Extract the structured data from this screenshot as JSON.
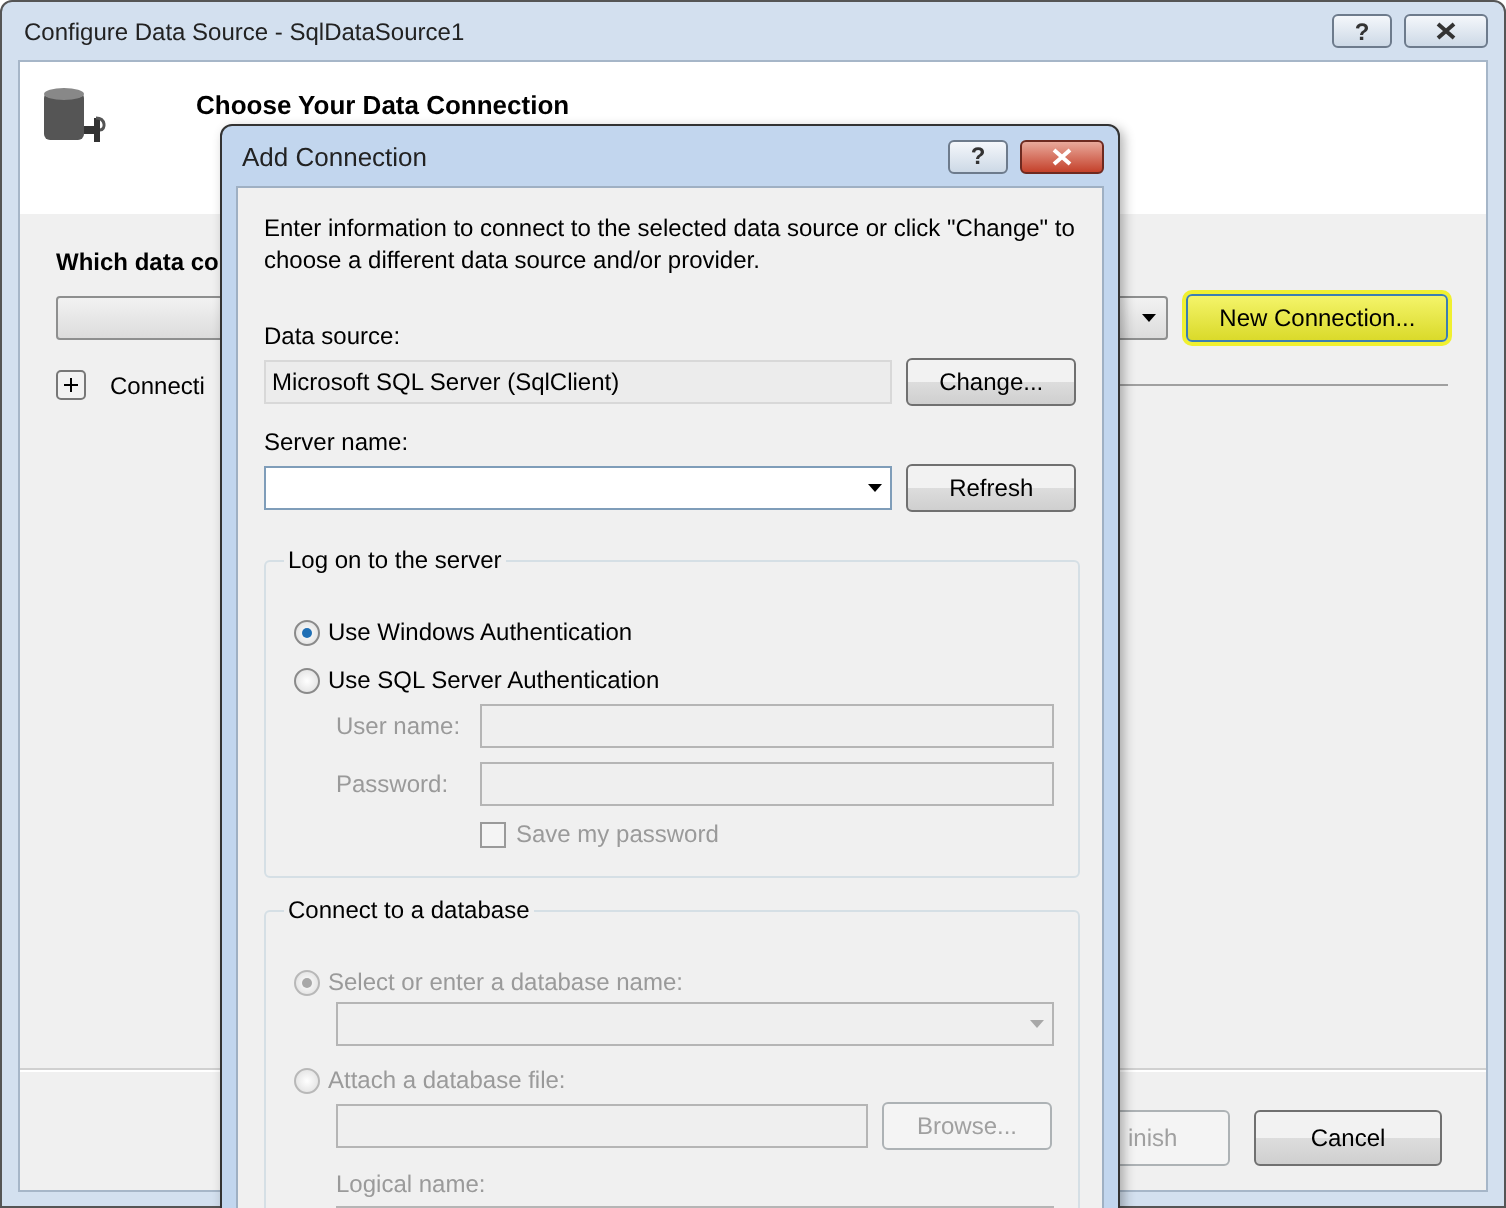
{
  "window": {
    "title": "Configure Data Source - SqlDataSource1",
    "help": "?"
  },
  "header": {
    "title": "Choose Your Data Connection"
  },
  "connection_prompt": "Which data co",
  "new_connection_button": {
    "label": "New Connection...",
    "highlighted": true
  },
  "connection_string": {
    "label": "Connecti",
    "expanded": false
  },
  "buttons": [
    {
      "label": "inish",
      "disabled": true
    },
    {
      "label": "Cancel",
      "disabled": false
    }
  ],
  "dialog": {
    "title": "Add Connection",
    "help": "?",
    "intro": "Enter information to connect to the selected data source or click \"Change\" to choose a different data source and/or provider.",
    "data_source": {
      "label": "Data source:",
      "value": "Microsoft SQL Server (SqlClient)",
      "button": "Change..."
    },
    "server_name": {
      "label": "Server name:",
      "button": "Refresh"
    },
    "logon": {
      "title": "Log on to the server",
      "options": [
        {
          "label": "Use Windows Authentication",
          "selected": true,
          "disabled": false
        },
        {
          "label": "Use SQL Server Authentication",
          "selected": false,
          "disabled": false
        }
      ],
      "fields": [
        {
          "label": "User name:",
          "disabled": true
        },
        {
          "label": "Password:",
          "disabled": true
        }
      ],
      "save_password": {
        "label": "Save my password",
        "checked": false,
        "disabled": true
      }
    },
    "database": {
      "title": "Connect to a database",
      "options": [
        {
          "label": "Select or enter a database name:",
          "selected": true,
          "disabled": true
        },
        {
          "label": "Attach a database file:",
          "selected": false,
          "disabled": true
        }
      ],
      "browse_button": {
        "label": "Browse...",
        "disabled": true
      },
      "logical_name_label": "Logical name:"
    }
  }
}
